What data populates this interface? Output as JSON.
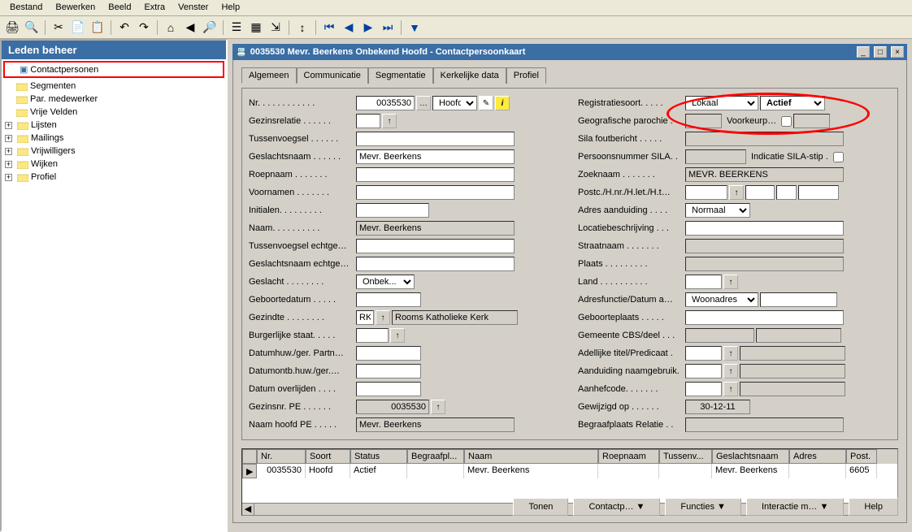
{
  "menu": {
    "bestand": "Bestand",
    "bewerken": "Bewerken",
    "beeld": "Beeld",
    "extra": "Extra",
    "venster": "Venster",
    "help": "Help"
  },
  "tree": {
    "title": "Leden beheer",
    "contactpersonen": "Contactpersonen",
    "segmenten": "Segmenten",
    "par": "Par. medewerker",
    "vrije": "Vrije Velden",
    "lijsten": "Lijsten",
    "mailings": "Mailings",
    "vrijwilligers": "Vrijwilligers",
    "wijken": "Wijken",
    "profiel": "Profiel"
  },
  "win": {
    "title": "0035530 Mevr. Beerkens Onbekend Hoofd - Contactpersoonkaart"
  },
  "tabs": {
    "algemeen": "Algemeen",
    "communicatie": "Communicatie",
    "segmentatie": "Segmentatie",
    "kerkelijke": "Kerkelijke data",
    "profiel": "Profiel"
  },
  "left": {
    "nr": "Nr. . . . . . . . . . . .",
    "nr_val": "0035530",
    "hoofd": "Hoofd",
    "gezinsrelatie": "Gezinsrelatie  . . . . . .",
    "tussenvoegsel": "Tussenvoegsel . . . . . .",
    "geslachtsnaam": "Geslachtsnaam . . . . . .",
    "geslachtsnaam_val": "Mevr. Beerkens",
    "roepnaam": "Roepnaam  . . . . . . .",
    "voornamen": "Voornamen . . . . . . .",
    "initialen": "Initialen. . . . . . . . .",
    "naam": "Naam. . . . . . . . . .",
    "naam_val": "Mevr. Beerkens",
    "tve": "Tussenvoegsel echtge…",
    "gne": "Geslachtsnaam echtge…",
    "geslacht": "Geslacht  . . . . . . . .",
    "geslacht_val": "Onbek...",
    "geboorte": "Geboortedatum . . . . .",
    "gezindte": "Gezindte  . . . . . . . .",
    "gezindte_code": "RK",
    "gezindte_val": "Rooms Katholieke Kerk",
    "burgerlijke": "Burgerlijke staat. . . . .",
    "datumhuw": "Datumhuw./ger. Partn…",
    "datumontb": "Datumontb.huw./ger.…",
    "overlijden": "Datum overlijden  . . . .",
    "gezinsnr": "Gezinsnr. PE  . . . . . .",
    "gezinsnr_val": "0035530",
    "naamhoofd": "Naam hoofd PE  . . . . .",
    "naamhoofd_val": "Mevr. Beerkens"
  },
  "right": {
    "registratie": "Registratiesoort. . . . .",
    "registratie_val": "Lokaal",
    "actief": "Actief",
    "geografische": "Geografische parochie .",
    "voorkeur": "Voorkeurp…",
    "sila": "Sila foutbericht  . . . . .",
    "persoonsnr": "Persoonsnummer SILA. .",
    "indicatie": "Indicatie SILA-stip .",
    "zoeknaam": "Zoeknaam  . . . . . . .",
    "zoeknaam_val": "MEVR. BEERKENS",
    "postc": "Postc./H.nr./H.let./H.t…",
    "adres": "Adres aanduiding  . . . .",
    "adres_val": "Normaal",
    "locatie": "Locatiebeschrijving  . . .",
    "straat": "Straatnaam  . . . . . . .",
    "plaats": "Plaats  . . . . . . . . .",
    "land": "Land  . . . . . . . . . .",
    "adresfunctie": "Adresfunctie/Datum a…",
    "adresfunctie_val": "Woonadres",
    "geboorteplaats": "Geboorteplaats  . . . . .",
    "gemeente": "Gemeente CBS/deel . . .",
    "adellijke": "Adellijke titel/Predicaat .",
    "aanduiding": "Aanduiding naamgebruik.",
    "aanhef": "Aanhefcode. . . . . . .",
    "gewijzigd": "Gewijzigd op  . . . . . .",
    "gewijzigd_val": "30-12-11",
    "begraaf": "Begraafplaats Relatie . ."
  },
  "grid": {
    "h_nr": "Nr.",
    "h_soort": "Soort",
    "h_status": "Status",
    "h_begraaf": "Begraafpl...",
    "h_naam": "Naam",
    "h_roep": "Roepnaam",
    "h_tussen": "Tussenv...",
    "h_gesl": "Geslachtsnaam",
    "h_adres": "Adres",
    "h_post": "Post.",
    "r_nr": "0035530",
    "r_soort": "Hoofd",
    "r_status": "Actief",
    "r_naam": "Mevr. Beerkens",
    "r_gesl": "Mevr. Beerkens",
    "r_post": "6605"
  },
  "footer": {
    "tonen": "Tonen",
    "contactp": "Contactp…",
    "functies": "Functies",
    "interactie": "Interactie m…",
    "help": "Help"
  }
}
